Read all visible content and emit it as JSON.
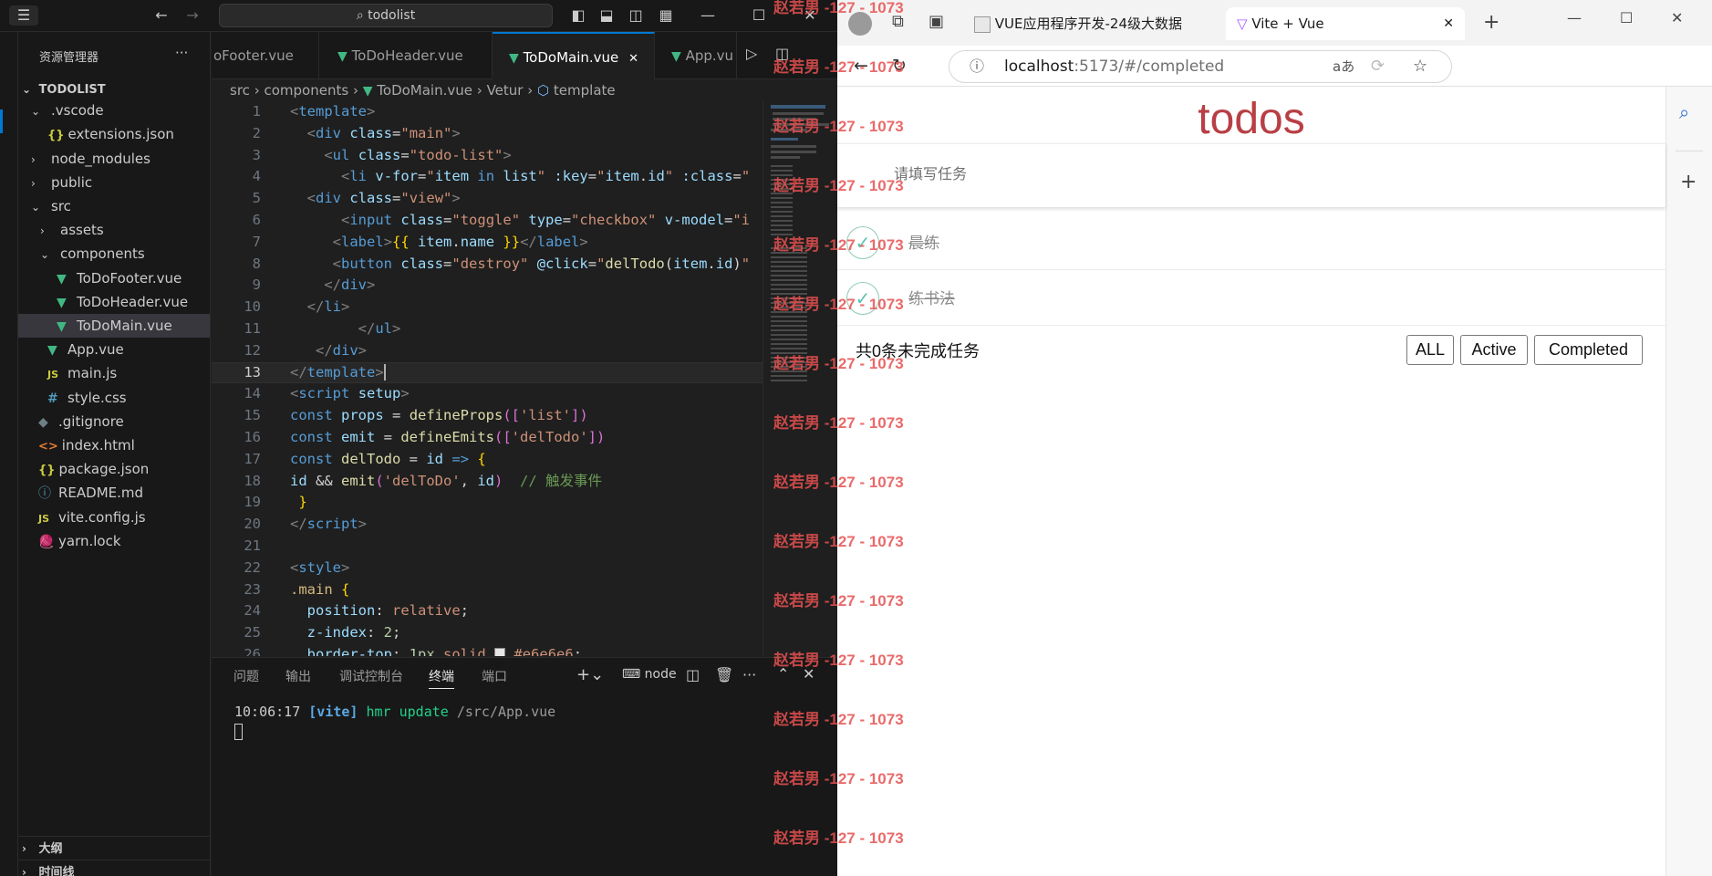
{
  "vscode": {
    "command_center": "todolist",
    "explorer_title": "资源管理器",
    "explorer_more": "···",
    "root": "TODOLIST",
    "tree": [
      {
        "label": ".vscode",
        "type": "folder-open",
        "indent": 1
      },
      {
        "label": "extensions.json",
        "type": "json",
        "indent": 2
      },
      {
        "label": "node_modules",
        "type": "folder",
        "indent": 1
      },
      {
        "label": "public",
        "type": "folder",
        "indent": 1
      },
      {
        "label": "src",
        "type": "folder-open",
        "indent": 1
      },
      {
        "label": "assets",
        "type": "folder",
        "indent": 2
      },
      {
        "label": "components",
        "type": "folder-open",
        "indent": 2
      },
      {
        "label": "ToDoFooter.vue",
        "type": "vue",
        "indent": 3
      },
      {
        "label": "ToDoHeader.vue",
        "type": "vue",
        "indent": 3
      },
      {
        "label": "ToDoMain.vue",
        "type": "vue",
        "indent": 3,
        "selected": true
      },
      {
        "label": "App.vue",
        "type": "vue",
        "indent": 2
      },
      {
        "label": "main.js",
        "type": "js",
        "indent": 2
      },
      {
        "label": "style.css",
        "type": "css",
        "indent": 2
      },
      {
        "label": ".gitignore",
        "type": "git",
        "indent": 1
      },
      {
        "label": "index.html",
        "type": "html",
        "indent": 1
      },
      {
        "label": "package.json",
        "type": "json",
        "indent": 1
      },
      {
        "label": "README.md",
        "type": "info",
        "indent": 1
      },
      {
        "label": "vite.config.js",
        "type": "js",
        "indent": 1
      },
      {
        "label": "yarn.lock",
        "type": "yarn",
        "indent": 1
      }
    ],
    "outline_label": "大纲",
    "timeline_label": "时间线",
    "tabs": [
      {
        "label": "oFooter.vue",
        "active": false
      },
      {
        "label": "ToDoHeader.vue",
        "active": false
      },
      {
        "label": "ToDoMain.vue",
        "active": true,
        "close": "✕"
      },
      {
        "label": "App.vu",
        "active": false
      }
    ],
    "breadcrumb": {
      "src": "src",
      "sep": "›",
      "components": "components",
      "file": "ToDoMain.vue",
      "vetur": "Vetur",
      "template": "template"
    },
    "current_line": 13,
    "line_numbers": [
      "1",
      "2",
      "3",
      "4",
      "5",
      "6",
      "7",
      "8",
      "9",
      "10",
      "11",
      "12",
      "13",
      "14",
      "15",
      "16",
      "17",
      "18",
      "19",
      "20",
      "21",
      "22",
      "23",
      "24",
      "25",
      "26"
    ],
    "panel_tabs": [
      "问题",
      "输出",
      "调试控制台",
      "终端",
      "端口"
    ],
    "active_panel_tab": "终端",
    "terminal_name": "node",
    "terminal": {
      "time": "10:06:17",
      "tag": "[vite]",
      "msg": "hmr update",
      "path": "/src/App.vue"
    }
  },
  "browser": {
    "tabs": [
      {
        "label": "VUE应用程序开发-24级大数据",
        "active": false
      },
      {
        "label": "Vite + Vue",
        "active": true,
        "close": "✕"
      }
    ],
    "new_tab": "+",
    "url_host": "localhost",
    "url_rest": ":5173/#/completed",
    "read_aloud": "aあ"
  },
  "todo": {
    "title": "todos",
    "placeholder": "请填写任务",
    "items": [
      {
        "label": "晨练",
        "done": true
      },
      {
        "label": "练书法",
        "done": true
      }
    ],
    "count_text": "共0条未完成任务",
    "filters": [
      "ALL",
      "Active",
      "Completed"
    ]
  },
  "watermark": {
    "text": "赵若男 -127 - 1073",
    "repeat": 15
  },
  "colors": {
    "todo_title": "#b83f45",
    "vs_bg": "#1f1f1f",
    "vs_accent": "#0078d4",
    "vue_green": "#41b883"
  }
}
